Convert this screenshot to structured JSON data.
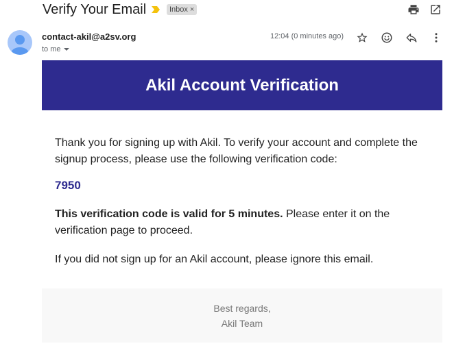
{
  "email": {
    "subject": "Verify Your Email",
    "label": "Inbox",
    "label_close": "×",
    "sender": "contact-akil@a2sv.org",
    "recipient": "to me",
    "timestamp": "12:04 (0 minutes ago)"
  },
  "icons": {
    "important": "important-marker-icon",
    "print": "print-icon",
    "open_new_window": "open-in-new-window-icon",
    "star": "star-icon",
    "emoji": "emoji-reaction-icon",
    "reply": "reply-icon",
    "more": "more-vert-icon",
    "recipient_dropdown": "chevron-down-icon"
  },
  "message": {
    "banner_title": "Akil Account Verification",
    "intro": "Thank you for signing up with Akil. To verify your account and complete the signup process, please use the following verification code:",
    "code": "7950",
    "validity_bold": "This verification code is valid for 5 minutes.",
    "validity_rest": " Please enter it on the verification page to proceed.",
    "ignore_note": "If you did not sign up for an Akil account, please ignore this email.",
    "sign_off": "Best regards,",
    "team": "Akil Team"
  },
  "colors": {
    "banner_bg": "#2e2b8f",
    "code": "#2e2b8f",
    "important_marker": "#f4c20d",
    "avatar": "#a8c7fa",
    "footer_bg": "#f8f8f8"
  }
}
